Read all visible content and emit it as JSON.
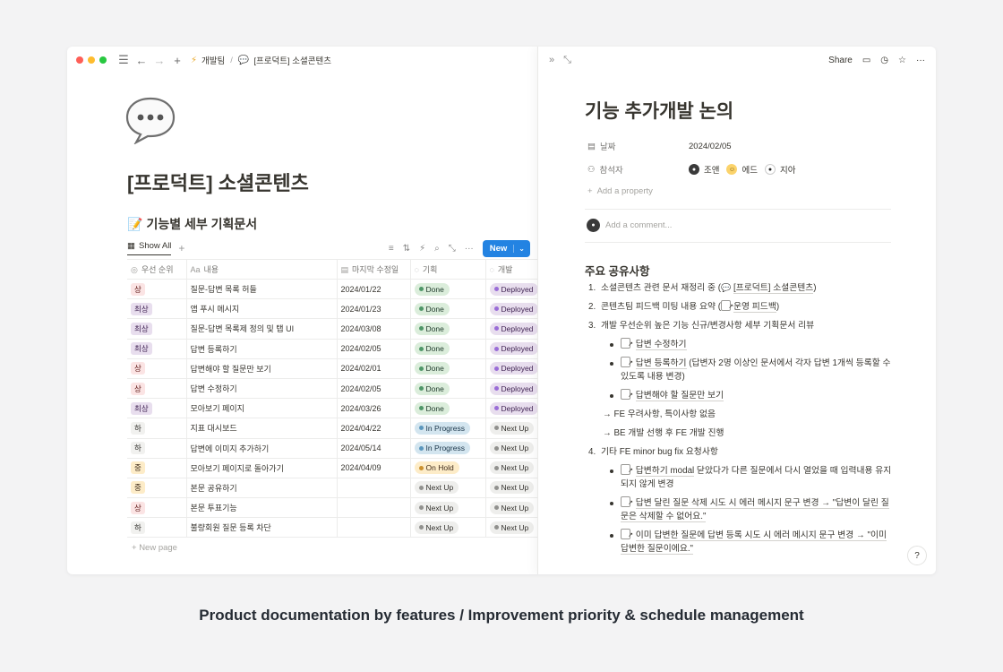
{
  "breadcrumb": {
    "workspace": "개발팀",
    "separator": "/",
    "page": "[프로덕트] 소셜콘텐츠"
  },
  "page": {
    "title": "[프로덕트] 소셜콘텐츠"
  },
  "database": {
    "title": "기능별 세부 기획문서",
    "view_label": "Show All",
    "new_button": "New",
    "columns": [
      "우선 순위",
      "내용",
      "마지막 수정일",
      "기획",
      "개발"
    ],
    "rows": [
      {
        "priority": "상",
        "title": "질문-답변 목록 허들",
        "date": "2024/01/22",
        "plan": "Done",
        "dev": "Deployed"
      },
      {
        "priority": "최상",
        "title": "앱 푸시 메시지",
        "date": "2024/01/23",
        "plan": "Done",
        "dev": "Deployed"
      },
      {
        "priority": "최상",
        "title": "질문-답변 목록제 정의 및 탭 UI",
        "date": "2024/03/08",
        "plan": "Done",
        "dev": "Deployed"
      },
      {
        "priority": "최상",
        "title": "답변 등록하기",
        "date": "2024/02/05",
        "plan": "Done",
        "dev": "Deployed"
      },
      {
        "priority": "상",
        "title": "답변해야 할 질문만 보기",
        "date": "2024/02/01",
        "plan": "Done",
        "dev": "Deployed"
      },
      {
        "priority": "상",
        "title": "답변 수정하기",
        "date": "2024/02/05",
        "plan": "Done",
        "dev": "Deployed"
      },
      {
        "priority": "최상",
        "title": "모아보기 페이지",
        "date": "2024/03/26",
        "plan": "Done",
        "dev": "Deployed"
      },
      {
        "priority": "하",
        "title": "지표 대시보드",
        "date": "2024/04/22",
        "plan": "In Progress",
        "dev": "Next Up"
      },
      {
        "priority": "하",
        "title": "답변에 이미지 추가하기",
        "date": "2024/05/14",
        "plan": "In Progress",
        "dev": "Next Up"
      },
      {
        "priority": "중",
        "title": "모아보기 페이지로 돌아가기",
        "date": "2024/04/09",
        "plan": "On Hold",
        "dev": "Next Up"
      },
      {
        "priority": "중",
        "title": "본문 공유하기",
        "date": "",
        "plan": "Next Up",
        "dev": "Next Up"
      },
      {
        "priority": "상",
        "title": "본문 투표기능",
        "date": "",
        "plan": "Next Up",
        "dev": "Next Up"
      },
      {
        "priority": "하",
        "title": "불량회원 질문 등록 차단",
        "date": "",
        "plan": "Next Up",
        "dev": "Next Up"
      }
    ],
    "new_page_label": "New page"
  },
  "doc": {
    "share_label": "Share",
    "title": "기능 추가개발 논의",
    "props": {
      "date_label": "날짜",
      "date_value": "2024/02/05",
      "attendees_label": "참석자",
      "attendees": [
        "조앤",
        "에드",
        "지아"
      ],
      "add_property": "Add a property"
    },
    "comment_placeholder": "Add a comment...",
    "section_title": "주요 공유사항",
    "items": {
      "i1_text": "소셜콘텐츠 관련 문서 재정리 중 (",
      "i1_link": "[프로덕트] 소셜콘텐츠",
      "i1_end": ")",
      "i2_text": "콘텐츠팀 피드백 미팅 내용 요약 (",
      "i2_link": "운영 피드백",
      "i2_end": ")",
      "i3_text": "개발 우선순위 높은 기능 신규/변경사항 세부 기획문서 리뷰",
      "i3_b1": "답변 수정하기",
      "i3_b2_link": "답변 등록하기",
      "i3_b2_rest": " (답변자 2명 이상인 문서에서 각자 답변 1개씩 등록할 수 있도록 내용 변경)",
      "i3_b3": "답변해야 할 질문만 보기",
      "arrow1": "→ FE 우려사항, 특이사항 없음",
      "arrow2": "→ BE 개발 선행 후 FE 개발 진행",
      "i4_text": "기타 FE minor bug fix 요청사항",
      "i4_b1_link": "답변하기 modal",
      "i4_b1_rest": " 닫았다가 다른 질문에서 다시 열었을 때 입력내용 유지되지 않게 변경",
      "i4_b2_link": "답변 달린 질문 삭제 시도 시 에러 메시지 문구 변경 → \"답변이 달린 질문은 삭제할 수 없어요.\"",
      "i4_b3_link": "이미 답변한 질문에 답변 등록 시도 시 에러 메시지 문구 변경 → \"이미 답변한 질문이에요.\""
    }
  },
  "caption": "Product documentation by features / Improvement priority & schedule management",
  "colors": {
    "accent": "#2383e2",
    "priority": {
      "최상": "#e8deee",
      "상": "#fbe4e4",
      "중": "#fdecc8",
      "하": "#f1f1ef"
    },
    "status": {
      "Done": "#dbeddb",
      "In Progress": "#d3e5ef",
      "On Hold": "#fdecc8",
      "Next Up": "#eeeeec",
      "Deployed": "#e8deee"
    }
  }
}
